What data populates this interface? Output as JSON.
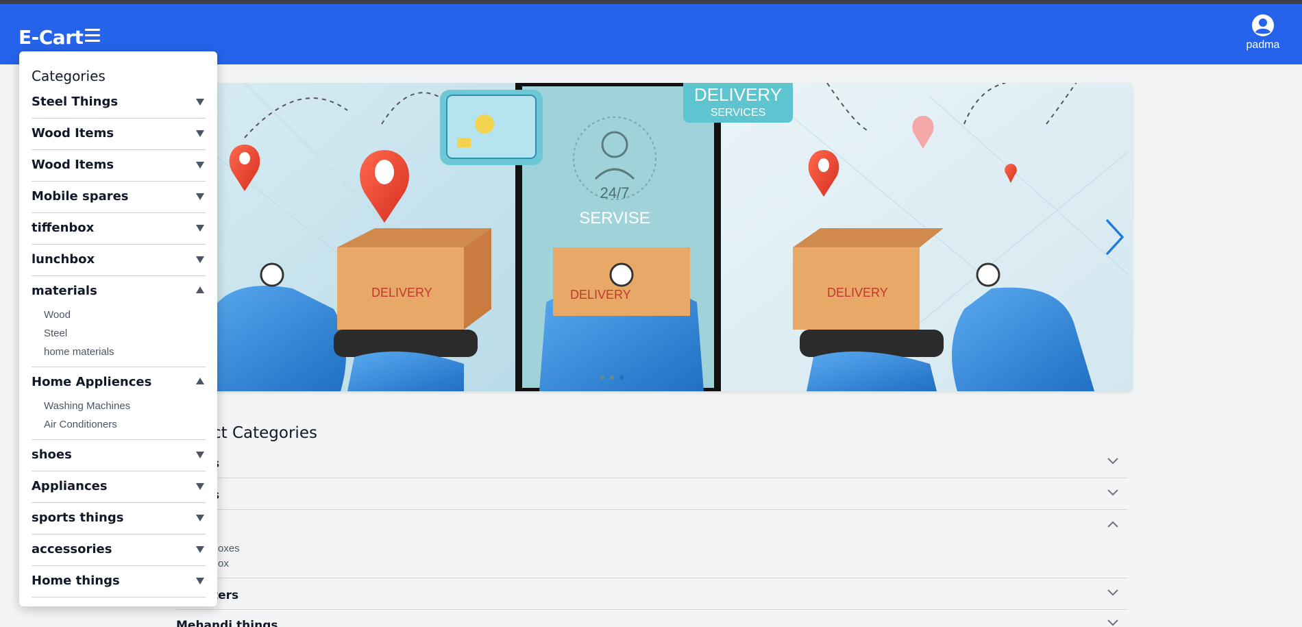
{
  "header": {
    "brand": "E-Cart",
    "menu_icon": "hamburger-icon",
    "user_icon": "user-circle-icon",
    "username": "padma",
    "accent": "#2563eb"
  },
  "carousel": {
    "banner_texts": [
      "DELIVERY",
      "SERVICES",
      "24/7",
      "SERVISE",
      "DELIVERY",
      "DELIVERY",
      "DELIVERY"
    ],
    "next_icon": "chevron-right-icon",
    "slide_count": 3,
    "active_slide": 3
  },
  "categories_menu": {
    "title": "Categories",
    "items": [
      {
        "label": "Steel Things",
        "expanded": false,
        "subs": []
      },
      {
        "label": "Wood Items",
        "expanded": false,
        "subs": []
      },
      {
        "label": "Wood Items",
        "expanded": false,
        "subs": []
      },
      {
        "label": "Mobile spares",
        "expanded": false,
        "subs": []
      },
      {
        "label": "tiffenbox",
        "expanded": false,
        "subs": []
      },
      {
        "label": "lunchbox",
        "expanded": false,
        "subs": []
      },
      {
        "label": "materials",
        "expanded": true,
        "subs": [
          "Wood",
          "Steel",
          "home materials"
        ]
      },
      {
        "label": "Home Appliences",
        "expanded": true,
        "subs": [
          "Washing Machines",
          "Air Conditioners"
        ]
      },
      {
        "label": "shoes",
        "expanded": false,
        "subs": []
      },
      {
        "label": "Appliances",
        "expanded": false,
        "subs": []
      },
      {
        "label": "sports things",
        "expanded": false,
        "subs": []
      },
      {
        "label": "accessories",
        "expanded": false,
        "subs": []
      },
      {
        "label": "Home things",
        "expanded": false,
        "subs": []
      }
    ]
  },
  "product_categories": {
    "title_visible": "ct Categories",
    "rows": [
      {
        "label": "s",
        "expanded": false
      },
      {
        "label": "s",
        "expanded": false
      },
      {
        "label": "",
        "expanded": true,
        "subs": [
          "oxes",
          "ox"
        ]
      },
      {
        "label": "ters",
        "expanded": false
      },
      {
        "label": "Mehandi things",
        "expanded": false
      }
    ]
  }
}
